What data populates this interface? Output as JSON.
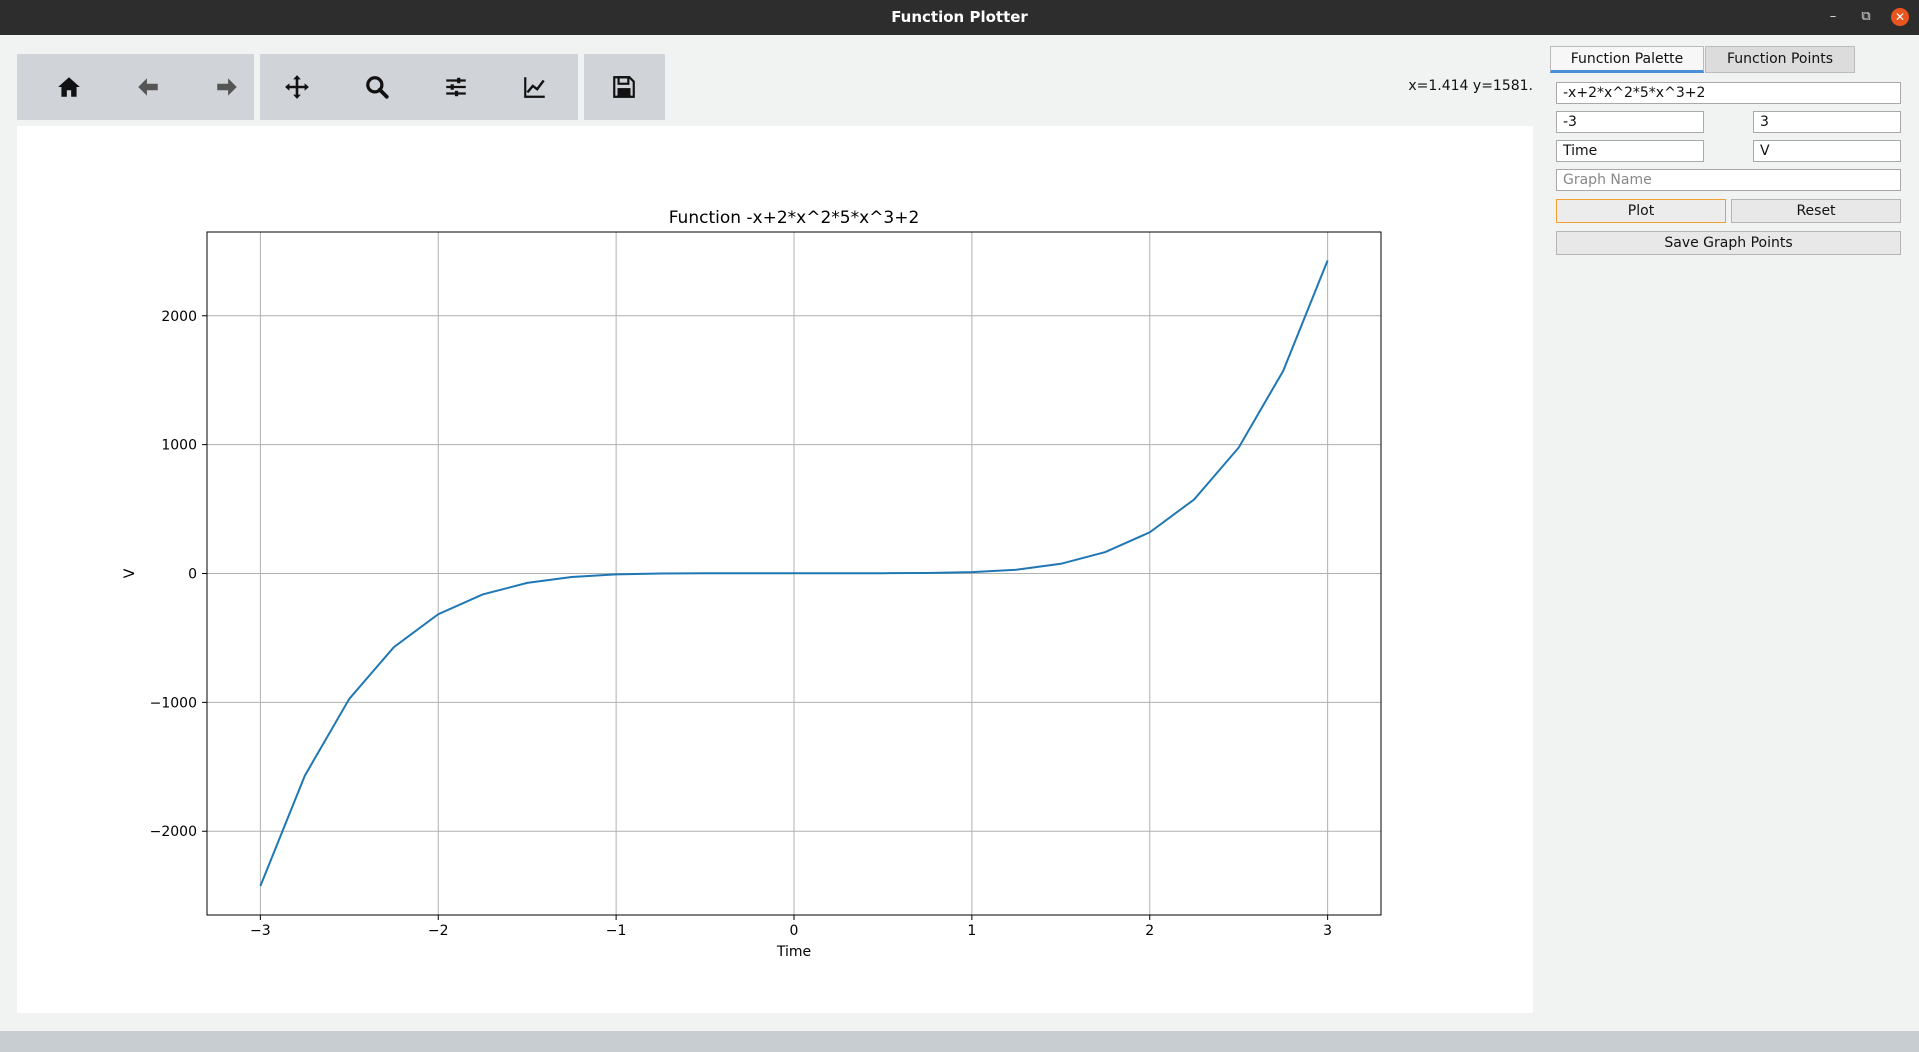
{
  "window": {
    "title": "Function Plotter"
  },
  "toolbar": {
    "icons": [
      "home-icon",
      "back-arrow-icon",
      "forward-arrow-icon",
      "pan-icon",
      "zoom-icon",
      "configure-subplots-icon",
      "edit-axis-icon",
      "save-icon"
    ]
  },
  "coords": "x=1.414 y=1581.",
  "tabs": [
    "Function Palette",
    "Function Points"
  ],
  "form": {
    "function": "-x+2*x^2*5*x^3+2",
    "x_min": "-3",
    "x_max": "3",
    "x_label": "Time",
    "y_label": "V",
    "graph_name_placeholder": "Graph Name",
    "plot_label": "Plot",
    "reset_label": "Reset",
    "save_points_label": "Save Graph Points"
  },
  "chart_data": {
    "type": "line",
    "title": "Function -x+2*x^2*5*x^3+2",
    "xlabel": "Time",
    "ylabel": "V",
    "xlim": [
      -3.3,
      3.3
    ],
    "ylim": [
      -2650,
      2650
    ],
    "xticks": [
      -3,
      -2,
      -1,
      0,
      1,
      2,
      3
    ],
    "xtick_labels": [
      "−3",
      "−2",
      "−1",
      "0",
      "1",
      "2",
      "3"
    ],
    "yticks": [
      -2000,
      -1000,
      0,
      1000,
      2000
    ],
    "ytick_labels": [
      "−2000",
      "−1000",
      "0",
      "1000",
      "2000"
    ],
    "grid": true,
    "color": "#1f77b4",
    "series": [
      {
        "x": [
          -3,
          -2.75,
          -2.5,
          -2.25,
          -2,
          -1.75,
          -1.5,
          -1.25,
          -1,
          -0.75,
          -0.5,
          -0.25,
          0,
          0.25,
          0.5,
          0.75,
          1,
          1.25,
          1.5,
          1.75,
          2,
          2.25,
          2.5,
          2.75,
          3
        ],
        "y": [
          -2425,
          -1569,
          -972,
          -572,
          -316,
          -162,
          -73,
          -27,
          -7,
          0,
          2,
          2,
          2,
          2,
          2,
          4,
          11,
          29,
          75,
          166,
          320,
          575,
          977,
          1572,
          2429
        ]
      }
    ]
  }
}
